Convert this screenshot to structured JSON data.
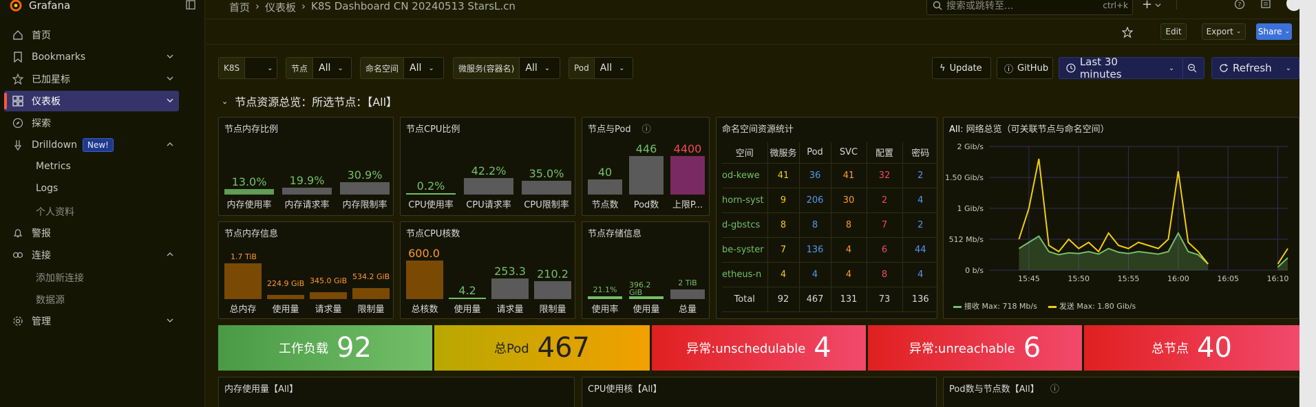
{
  "app": {
    "name": "Grafana"
  },
  "sidebar": {
    "items": [
      {
        "label": "首页",
        "icon": "home-icon"
      },
      {
        "label": "Bookmarks",
        "icon": "bookmark-icon"
      },
      {
        "label": "已加星标",
        "icon": "star-icon"
      },
      {
        "label": "仪表板",
        "icon": "dashboards-icon"
      },
      {
        "label": "探索",
        "icon": "compass-icon"
      },
      {
        "label": "Drilldown",
        "icon": "drilldown-icon",
        "badge": "New!"
      },
      {
        "label": "警报",
        "icon": "bell-icon"
      },
      {
        "label": "连接",
        "icon": "connections-icon"
      },
      {
        "label": "管理",
        "icon": "gear-icon"
      }
    ],
    "drilldown_sub": [
      "Metrics",
      "Logs",
      "个人资料"
    ],
    "connections_sub": [
      "添加新连接",
      "数据源"
    ]
  },
  "breadcrumb": [
    "首页",
    "›",
    "仪表板",
    "›",
    "K8S Dashboard CN 20240513 StarsL.cn"
  ],
  "search": {
    "placeholder": "搜索或跳转至...",
    "shortcut": "ctrl+k"
  },
  "toolbar": {
    "edit": "Edit",
    "export": "Export",
    "share": "Share"
  },
  "variables": [
    {
      "label": "K8S",
      "value": ""
    },
    {
      "label": "节点",
      "value": "All"
    },
    {
      "label": "命名空间",
      "value": "All"
    },
    {
      "label": "微服务(容器名)",
      "value": "All"
    },
    {
      "label": "Pod",
      "value": "All"
    }
  ],
  "actions": {
    "update": "Update",
    "github": "GitHub",
    "time_range": "Last 30 minutes",
    "refresh": "Refresh"
  },
  "row_title": "节点资源总览：所选节点：【All】",
  "panels": {
    "mem_ratio": {
      "title": "节点内存比例",
      "bars": [
        {
          "value": "13.0%",
          "label": "内存使用率",
          "fill": 0.13
        },
        {
          "value": "19.9%",
          "label": "内存请求率",
          "fill": 0.2
        },
        {
          "value": "30.9%",
          "label": "内存限制率",
          "fill": 0.31
        }
      ]
    },
    "cpu_ratio": {
      "title": "节点CPU比例",
      "bars": [
        {
          "value": "0.2%",
          "label": "CPU使用率",
          "fill": 0.02
        },
        {
          "value": "42.2%",
          "label": "CPU请求率",
          "fill": 0.42
        },
        {
          "value": "35.0%",
          "label": "CPU限制率",
          "fill": 0.35
        }
      ]
    },
    "node_pod": {
      "title": "节点与Pod",
      "bars": [
        {
          "value": "40",
          "label": "节点数"
        },
        {
          "value": "446",
          "label": "Pod数"
        },
        {
          "value": "4400",
          "label": "上限P..."
        }
      ]
    },
    "mem_info": {
      "title": "节点内存信息",
      "bars": [
        {
          "value": "1.7 TiB",
          "label": "总内存"
        },
        {
          "value": "224.9 GiB",
          "label": "使用量"
        },
        {
          "value": "345.0 GiB",
          "label": "请求量"
        },
        {
          "value": "534.2 GiB",
          "label": "限制量"
        }
      ]
    },
    "cpu_cores": {
      "title": "节点CPU核数",
      "bars": [
        {
          "value": "600.0",
          "label": "总核数"
        },
        {
          "value": "4.2",
          "label": "使用量"
        },
        {
          "value": "253.3",
          "label": "请求量"
        },
        {
          "value": "210.2",
          "label": "限制量"
        }
      ]
    },
    "storage": {
      "title": "节点存储信息",
      "bars": [
        {
          "value": "21.1%",
          "label": "使用率"
        },
        {
          "value": "396.2 GiB",
          "label": "使用量"
        },
        {
          "value": "2 TiB",
          "label": "总量"
        }
      ]
    },
    "ns_table": {
      "title": "命名空间资源统计",
      "headers": [
        "空间",
        "微服务",
        "Pod",
        "SVC",
        "配置",
        "密码"
      ],
      "rows": [
        [
          "od-kewe",
          "41",
          "36",
          "41",
          "32",
          "2"
        ],
        [
          "horn-syst",
          "9",
          "206",
          "30",
          "2",
          "4"
        ],
        [
          "d-gbstcs",
          "8",
          "8",
          "8",
          "7",
          "2"
        ],
        [
          "be-syster",
          "7",
          "136",
          "4",
          "6",
          "44"
        ],
        [
          "etheus-n",
          "4",
          "4",
          "4",
          "8",
          "4"
        ]
      ],
      "total": [
        "Total",
        "92",
        "467",
        "131",
        "73",
        "136"
      ]
    },
    "network": {
      "title_prefix": "All",
      "title": "网络总览（可关联节点与命名空间）",
      "legend": [
        {
          "name": "接收",
          "max": "Max: 718 Mb/s",
          "color": "#73bf69"
        },
        {
          "name": "发送",
          "max": "Max: 1.80 Gib/s",
          "color": "#f2cc0c"
        }
      ]
    }
  },
  "chart_data": {
    "type": "line",
    "title": "网络总览（可关联节点与命名空间）",
    "x": [
      "15:41",
      "15:42",
      "15:43",
      "15:44",
      "15:45",
      "15:46",
      "15:47",
      "15:48",
      "15:49",
      "15:50",
      "15:51",
      "15:52",
      "15:53",
      "15:54",
      "15:55",
      "15:56",
      "15:57",
      "15:58",
      "15:59",
      "16:00",
      "16:01",
      "16:02",
      "16:03",
      "16:04",
      "16:05",
      "16:06",
      "16:07",
      "16:08",
      "16:09",
      "16:10",
      "16:11"
    ],
    "x_ticks": [
      "15:45",
      "15:50",
      "15:55",
      "16:00",
      "16:05",
      "16:10"
    ],
    "y_ticks": [
      "0 b/s",
      "512 Mb/s",
      "1 Gib/s",
      "1.50 Gib/s",
      "2 Gib/s"
    ],
    "ylim": [
      0,
      2
    ],
    "series": [
      {
        "name": "接收",
        "values": [
          null,
          null,
          null,
          0.35,
          0.45,
          0.55,
          0.3,
          0.25,
          0.28,
          0.27,
          0.3,
          0.26,
          0.35,
          0.29,
          0.27,
          0.3,
          0.28,
          0.26,
          0.3,
          0.6,
          0.3,
          0.25,
          0.1,
          null,
          null,
          null,
          null,
          null,
          null,
          0.05,
          0.2
        ]
      },
      {
        "name": "发送",
        "values": [
          null,
          null,
          null,
          0.5,
          1.0,
          1.8,
          0.4,
          0.3,
          0.5,
          0.35,
          0.45,
          0.3,
          0.6,
          0.4,
          0.35,
          0.45,
          0.4,
          0.35,
          0.5,
          1.6,
          0.45,
          0.3,
          0.1,
          null,
          null,
          null,
          null,
          null,
          null,
          0.1,
          0.35
        ]
      }
    ]
  },
  "stats": [
    {
      "label": "工作负载",
      "value": "92"
    },
    {
      "label": "总Pod",
      "value": "467"
    },
    {
      "label": "异常:unschedulable",
      "value": "4"
    },
    {
      "label": "异常:unreachable",
      "value": "6"
    },
    {
      "label": "总节点",
      "value": "40"
    }
  ],
  "bottom_panels": [
    "内存使用量【All】",
    "CPU使用核【All】",
    "Pod数与节点数【All】"
  ]
}
